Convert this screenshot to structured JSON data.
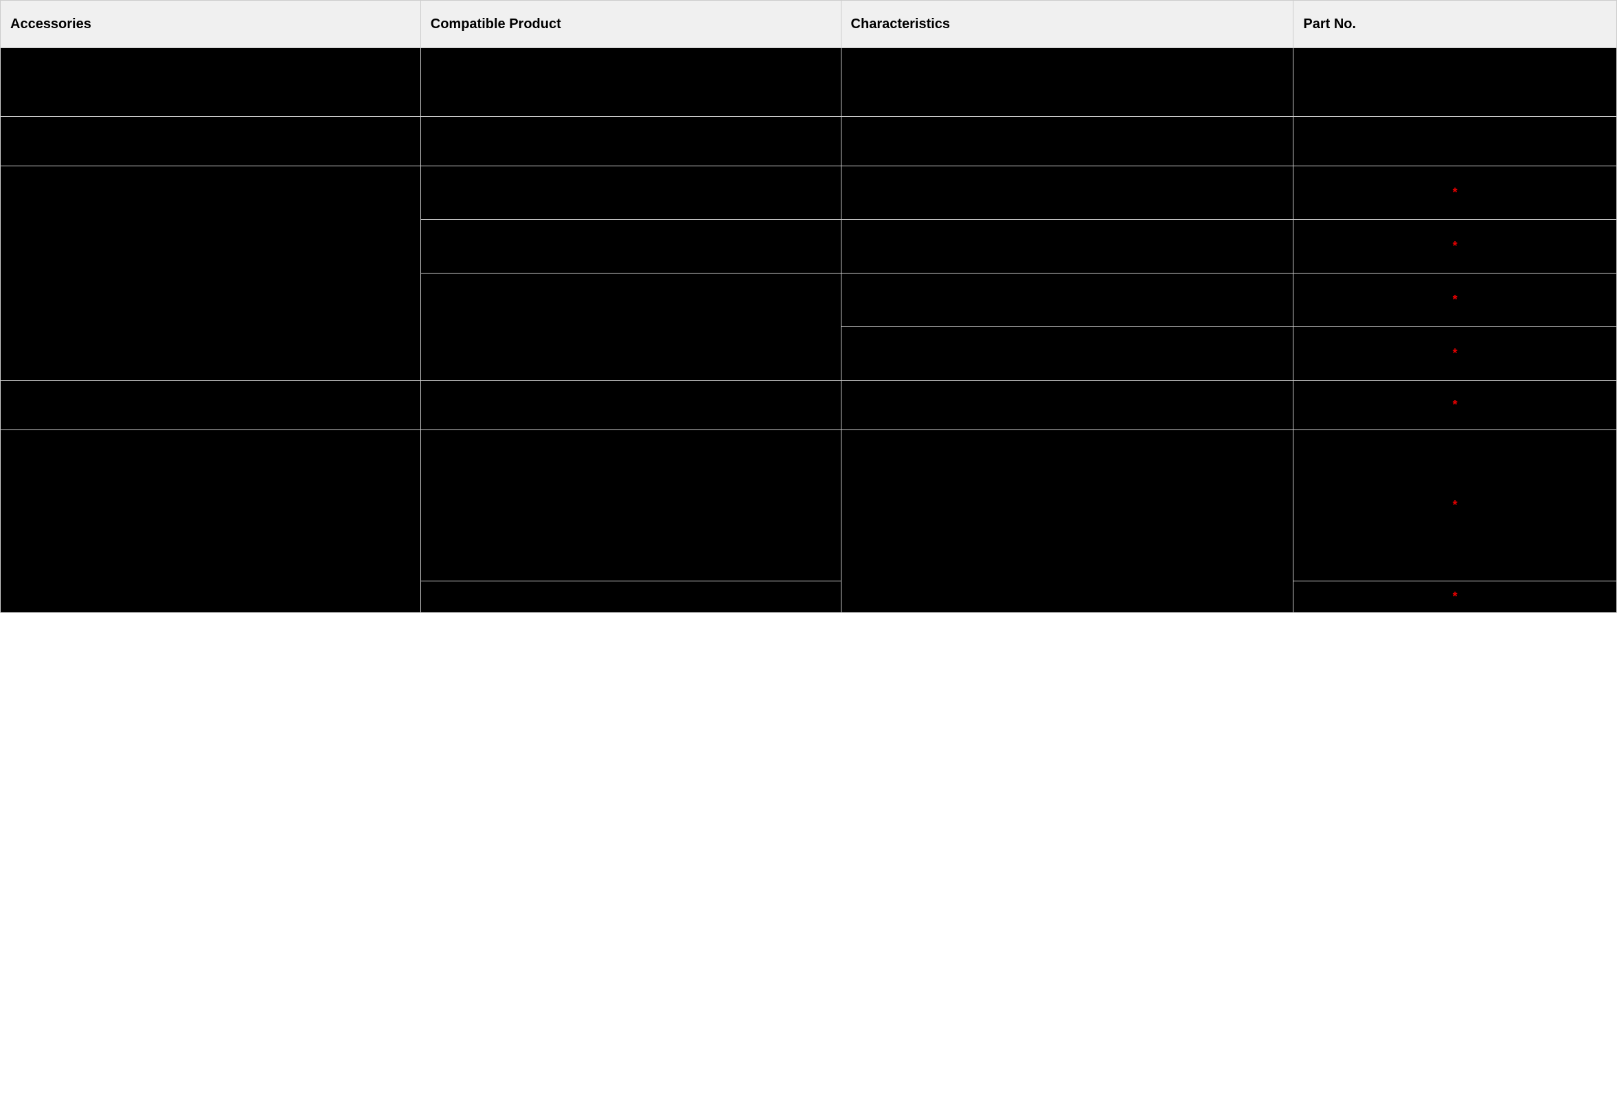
{
  "table": {
    "headers": {
      "accessories": "Accessories",
      "compatible": "Compatible Product",
      "characteristics": "Characteristics",
      "partno": "Part No."
    },
    "asterisk": "*",
    "rows": {
      "r1": {
        "accessories": "",
        "compatible": "",
        "characteristics": "",
        "partno": ""
      },
      "r2": {
        "accessories": "",
        "compatible": "",
        "characteristics": "",
        "partno": ""
      },
      "r3": {
        "accessories": "",
        "compatible": "",
        "characteristics": ""
      },
      "r4": {
        "compatible": "",
        "characteristics": ""
      },
      "r5": {
        "compatible": "",
        "characteristics": ""
      },
      "r6": {
        "characteristics": ""
      },
      "r7": {
        "accessories": "",
        "compatible": "",
        "characteristics": ""
      },
      "r8": {
        "accessories": "",
        "compatible": "",
        "characteristics": ""
      },
      "r9": {
        "compatible": ""
      }
    }
  }
}
